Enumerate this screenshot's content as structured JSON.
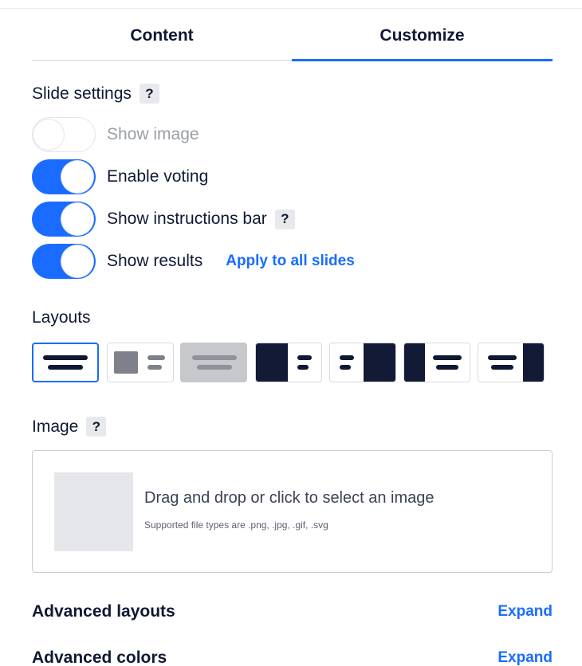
{
  "tabs": [
    {
      "label": "Content",
      "active": false
    },
    {
      "label": "Customize",
      "active": true
    }
  ],
  "slide_settings": {
    "title": "Slide settings",
    "help": "?",
    "toggles": [
      {
        "label": "Show image",
        "on": false,
        "disabled": true
      },
      {
        "label": "Enable voting",
        "on": true
      },
      {
        "label": "Show instructions bar",
        "on": true,
        "help": "?"
      },
      {
        "label": "Show results",
        "on": true,
        "link": "Apply to all slides"
      }
    ]
  },
  "layouts": {
    "title": "Layouts",
    "options": [
      {
        "name": "text-only",
        "selected": true
      },
      {
        "name": "image-left-small"
      },
      {
        "name": "image-background",
        "disabled": true
      },
      {
        "name": "image-left-large"
      },
      {
        "name": "image-right-large"
      },
      {
        "name": "image-left-half"
      },
      {
        "name": "image-right-half"
      }
    ]
  },
  "image": {
    "title": "Image",
    "help": "?",
    "dropzone_text": "Drag and drop or click to select an image",
    "supported_text": "Supported file types are .png, .jpg, .gif, .svg"
  },
  "advanced": [
    {
      "label": "Advanced layouts",
      "action": "Expand"
    },
    {
      "label": "Advanced colors",
      "action": "Expand"
    }
  ],
  "colors": {
    "accent": "#196cff",
    "text": "#101834",
    "muted": "#9a9ea8"
  }
}
